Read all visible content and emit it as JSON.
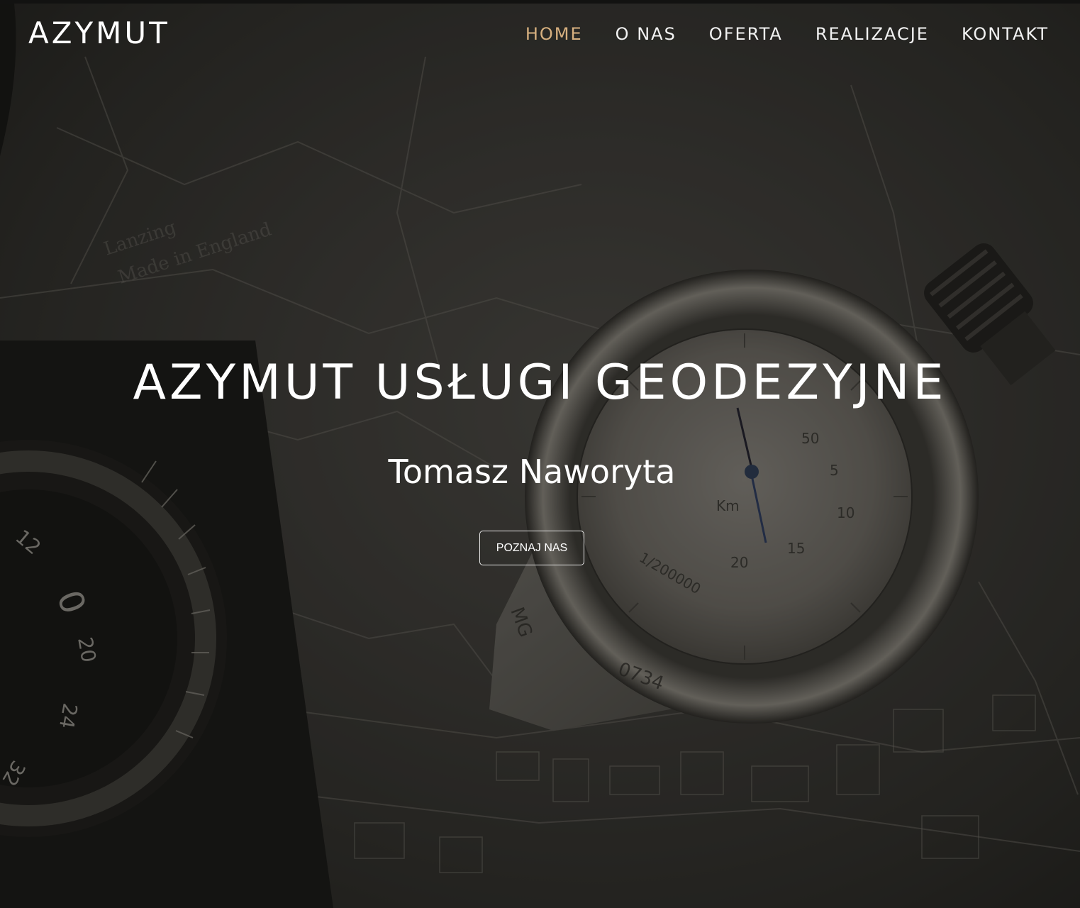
{
  "brand": {
    "logo_text": "AZYMUT"
  },
  "nav": {
    "items": [
      {
        "label": "HOME",
        "active": true
      },
      {
        "label": "O NAS",
        "active": false
      },
      {
        "label": "OFERTA",
        "active": false
      },
      {
        "label": "REALIZACJE",
        "active": false
      },
      {
        "label": "KONTAKT",
        "active": false
      }
    ]
  },
  "hero": {
    "headline": "AZYMUT USŁUGI GEODEZYJNE",
    "subtitle": "Tomasz Naworyta",
    "cta_label": "POZNAJ NAS",
    "background_image": "vintage-compass-and-map-photo"
  },
  "colors": {
    "accent": "#d7b07f",
    "text": "#ffffff"
  }
}
